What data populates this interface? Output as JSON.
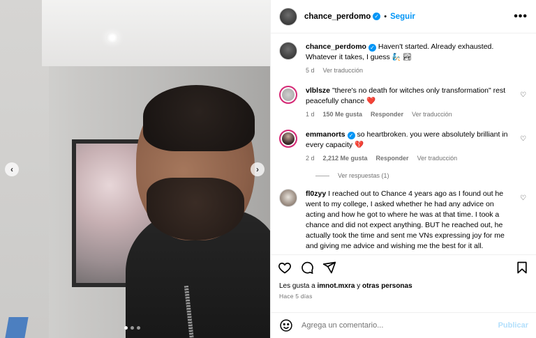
{
  "post": {
    "username": "chance_perdomo",
    "follow_label": "Seguir",
    "separator": "•",
    "more_label": "•••",
    "caption_line1": "Haven't started. Already exhausted.",
    "caption_line2": "Whatever it takes, I guess",
    "caption_emoji": "🧞 🏞",
    "caption_age": "5 d",
    "caption_translate": "Ver traducción"
  },
  "comments": [
    {
      "username": "vlblsze",
      "text": "\"there's no death for witches only transformation\" rest peacefully chance",
      "emoji": "❤️",
      "age": "1 d",
      "likes": "150 Me gusta",
      "reply": "Responder",
      "translate": "Ver traducción"
    },
    {
      "username": "emmanorts",
      "text": "so heartbroken. you were absolutely brilliant in every capacity",
      "emoji": "💔",
      "age": "2 d",
      "likes": "2,212 Me gusta",
      "reply": "Responder",
      "translate": "Ver traducción",
      "view_replies": "Ver respuestas (1)"
    },
    {
      "username": "fl0zyy",
      "text": "I reached out to Chance 4 years ago as I found out he went to my college, I asked whether he had any advice on acting and how he got to where he was at that time. I took a chance and did not expect anything. BUT he reached out, he actually took the time and sent me VNs expressing joy for me and giving me advice and wishing me the best for it all."
    }
  ],
  "likes": {
    "prefix": "Les gusta a",
    "user": "imnot.mxra",
    "connector": "y",
    "others": "otras personas"
  },
  "time_ago": "Hace 5 días",
  "add_comment": {
    "placeholder": "Agrega un comentario...",
    "publish_label": "Publicar"
  },
  "carousel": {
    "prev": "‹",
    "next": "›"
  },
  "colors": {
    "accent": "#0095f6",
    "muted": "#737373",
    "publish_disabled": "#b2dffc"
  }
}
